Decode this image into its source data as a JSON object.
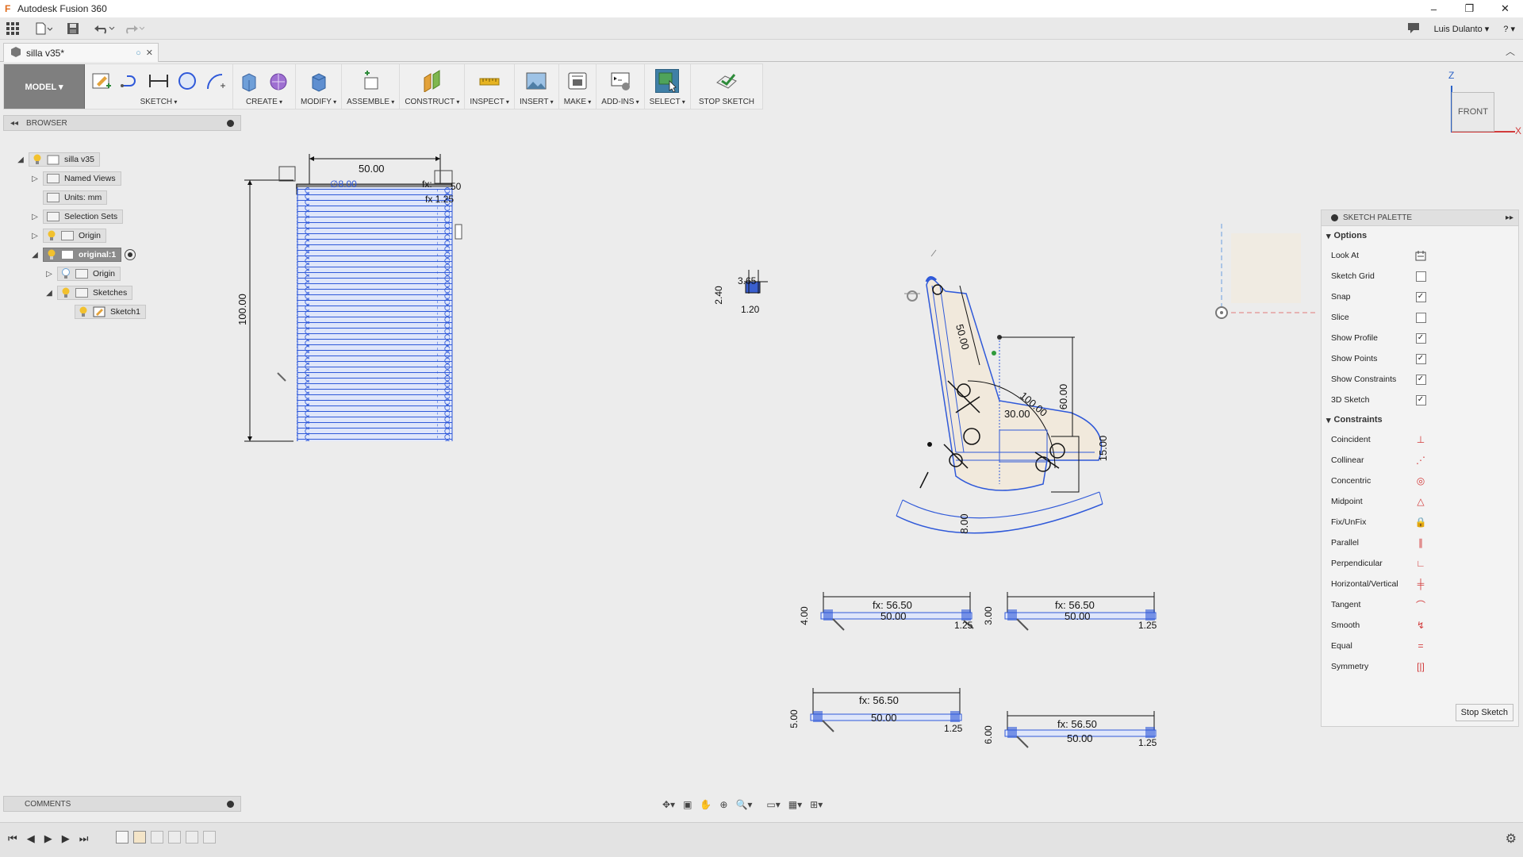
{
  "window": {
    "title": "Autodesk Fusion 360",
    "minimize": "–",
    "restore": "❐",
    "close": "✕"
  },
  "qat": {
    "user": "Luis Dulanto ▾",
    "help": "? ▾"
  },
  "document_tab": {
    "name": "silla v35*",
    "close": "✕"
  },
  "toolbar": {
    "workspace": "MODEL ▾",
    "groups": [
      {
        "label": "SKETCH"
      },
      {
        "label": "CREATE"
      },
      {
        "label": "MODIFY"
      },
      {
        "label": "ASSEMBLE"
      },
      {
        "label": "CONSTRUCT"
      },
      {
        "label": "INSPECT"
      },
      {
        "label": "INSERT"
      },
      {
        "label": "MAKE"
      },
      {
        "label": "ADD-INS"
      },
      {
        "label": "SELECT"
      },
      {
        "label": "STOP SKETCH"
      }
    ]
  },
  "browser": {
    "title": "BROWSER",
    "nodes": [
      {
        "label": "silla v35"
      },
      {
        "label": "Named Views"
      },
      {
        "label": "Units: mm"
      },
      {
        "label": "Selection Sets"
      },
      {
        "label": "Origin"
      },
      {
        "label": "original:1"
      },
      {
        "label": "Origin"
      },
      {
        "label": "Sketches"
      },
      {
        "label": "Sketch1"
      }
    ]
  },
  "comments": {
    "title": "COMMENTS"
  },
  "viewcube": {
    "face": "FRONT",
    "axis_z": "Z",
    "axis_x": "X"
  },
  "palette": {
    "title": "SKETCH PALETTE",
    "options_title": "Options",
    "options": [
      {
        "label": "Look At",
        "icon": "look-at-icon"
      },
      {
        "label": "Sketch Grid",
        "checked": false
      },
      {
        "label": "Snap",
        "checked": true
      },
      {
        "label": "Slice",
        "checked": false
      },
      {
        "label": "Show Profile",
        "checked": true
      },
      {
        "label": "Show Points",
        "checked": true
      },
      {
        "label": "Show Constraints",
        "checked": true
      },
      {
        "label": "3D Sketch",
        "checked": true
      }
    ],
    "constraints_title": "Constraints",
    "constraints": [
      {
        "label": "Coincident",
        "icon": "coincident-icon",
        "glyph": "⊥"
      },
      {
        "label": "Collinear",
        "icon": "collinear-icon",
        "glyph": "⋰"
      },
      {
        "label": "Concentric",
        "icon": "concentric-icon",
        "glyph": "◎"
      },
      {
        "label": "Midpoint",
        "icon": "midpoint-icon",
        "glyph": "△"
      },
      {
        "label": "Fix/UnFix",
        "icon": "lock-icon",
        "glyph": "🔒"
      },
      {
        "label": "Parallel",
        "icon": "parallel-icon",
        "glyph": "∥"
      },
      {
        "label": "Perpendicular",
        "icon": "perpendicular-icon",
        "glyph": "∟"
      },
      {
        "label": "Horizontal/Vertical",
        "icon": "horizontal-vertical-icon",
        "glyph": "╪"
      },
      {
        "label": "Tangent",
        "icon": "tangent-icon",
        "glyph": "⌒"
      },
      {
        "label": "Smooth",
        "icon": "smooth-icon",
        "glyph": "↯"
      },
      {
        "label": "Equal",
        "icon": "equal-icon",
        "glyph": "="
      },
      {
        "label": "Symmetry",
        "icon": "symmetry-icon",
        "glyph": "[|]"
      }
    ],
    "stop_button": "Stop Sketch"
  },
  "sketch_dimensions": {
    "tall_width": "50.00",
    "tall_height": "100.00",
    "tall_inner": "∅8.00",
    "tall_fx": "fx:",
    "tall_r1": "50",
    "tall_r2": "fx 1.25",
    "small_a": "2.40",
    "small_b": "3.65",
    "small_c": "1.20",
    "chair_50": "50.00",
    "chair_100": "100.00",
    "chair_30": "30.00",
    "chair_60": "60.00",
    "chair_15": "15.00",
    "chair_8": "8.00",
    "b1_fx": "fx: 56.50",
    "b1_len": "50.00",
    "b1_h": "4.00",
    "b1_r": "1.25",
    "b2_fx": "fx: 56.50",
    "b2_len": "50.00",
    "b2_h": "3.00",
    "b2_r": "1.25",
    "b3_fx": "fx: 56.50",
    "b3_len": "50.00",
    "b3_h": "5.00",
    "b3_r": "1.25",
    "b4_fx": "fx: 56.50",
    "b4_len": "50.00",
    "b4_h": "6.00",
    "b4_r": "1.25"
  },
  "colors": {
    "sketch_blue": "#2f59d9",
    "profile_fill": "#f1e9dc",
    "workspace_gray": "#7f7f7f",
    "select_blue": "#3f7fa6"
  }
}
